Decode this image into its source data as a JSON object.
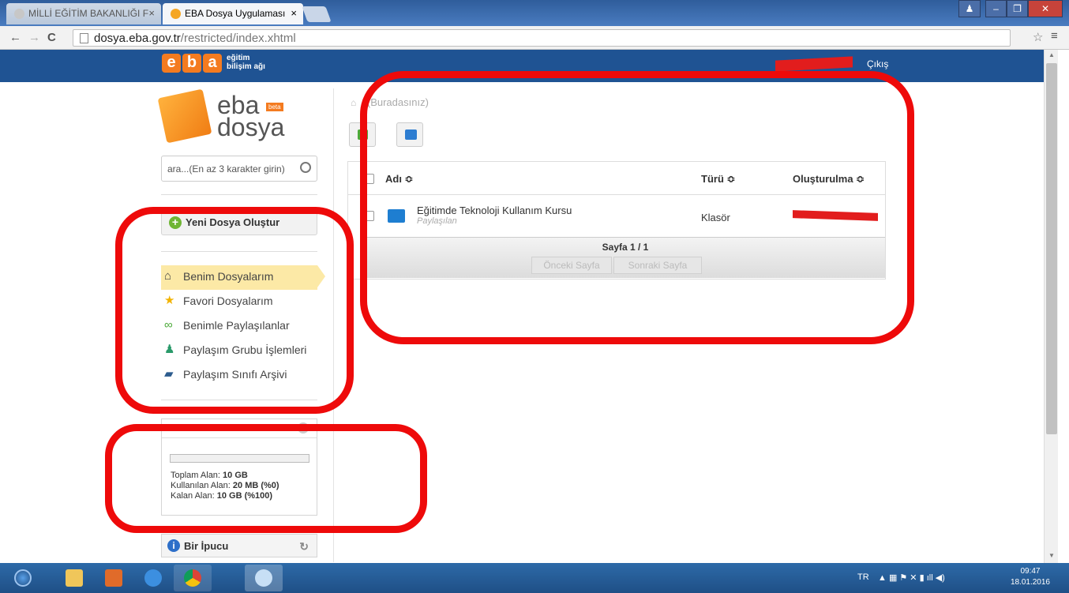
{
  "browser": {
    "tabs": [
      {
        "label": "MİLLİ EĞİTİM BAKANLIĞI F"
      },
      {
        "label": "EBA Dosya Uygulaması"
      }
    ],
    "url_domain": "dosya.eba.gov.tr",
    "url_path": "/restricted/index.xhtml",
    "tab_close": "×"
  },
  "site": {
    "logo_letters": [
      "e",
      "b",
      "a"
    ],
    "logo_sub1": "eğitim",
    "logo_sub2": "bilişim ağı",
    "logout": "Çıkış"
  },
  "sidebar": {
    "brand_top": "eba",
    "brand_bottom": "dosya",
    "brand_badge": "beta",
    "search_placeholder": "ara...(En az 3 karakter girin)",
    "new_file": "Yeni Dosya Oluştur",
    "menu": [
      {
        "label": "Benim Dosyalarım",
        "icon": "home-icon",
        "active": true
      },
      {
        "label": "Favori Dosyalarım",
        "icon": "star-icon"
      },
      {
        "label": "Benimle Paylaşılanlar",
        "icon": "link-icon"
      },
      {
        "label": "Paylaşım Grubu İşlemleri",
        "icon": "group-icon"
      },
      {
        "label": "Paylaşım Sınıfı Arşivi",
        "icon": "archive-icon"
      }
    ],
    "storage": {
      "used_percent": 0,
      "total_label": "Toplam Alan:",
      "total_value": "10 GB",
      "used_label": "Kullanılan Alan:",
      "used_value": "20 MB (%0)",
      "free_label": "Kalan Alan:",
      "free_value": "10 GB (%100)"
    },
    "tip_title": "Bir İpucu"
  },
  "main": {
    "breadcrumb": "(Buradasınız)",
    "columns": [
      "Adı ≎",
      "Türü ≎",
      "Oluşturulma ≎"
    ],
    "rows": [
      {
        "name": "Eğitimde Teknoloji Kullanım Kursu",
        "subtitle": "Paylaşılan",
        "type": "Klasör"
      }
    ],
    "pager": {
      "label": "Sayfa 1 / 1",
      "prev": "Önceki Sayfa",
      "next": "Sonraki Sayfa"
    }
  },
  "taskbar": {
    "lang": "TR",
    "time": "09:47",
    "date": "18.01.2016"
  },
  "colors": {
    "header": "#1f5393",
    "accent": "#f47b20",
    "annotation": "#ee0a0a"
  }
}
